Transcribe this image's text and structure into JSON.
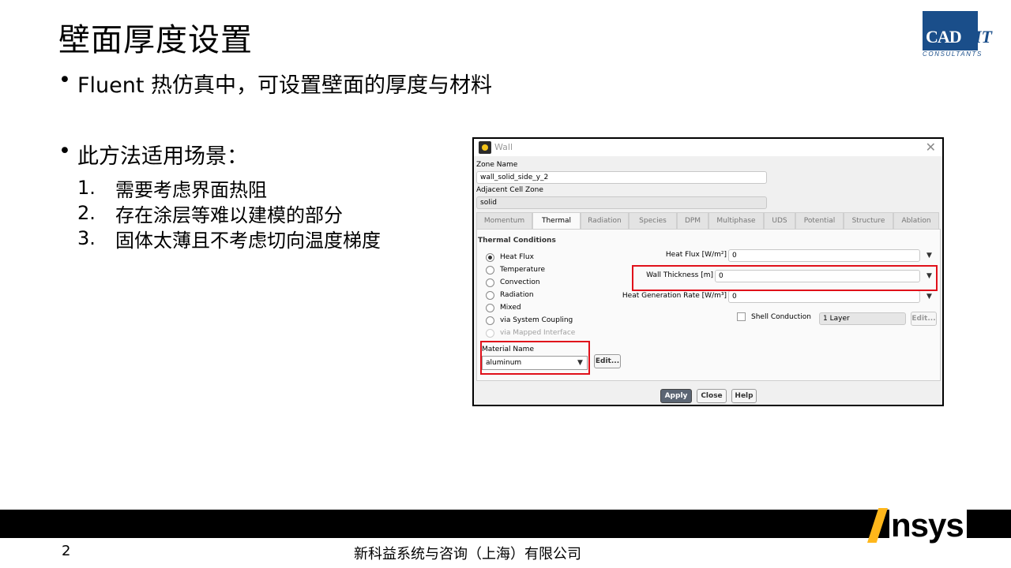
{
  "slide": {
    "title": "壁面厚度设置",
    "bullet1": "Fluent 热仿真中，可设置壁面的厚度与材料",
    "bullet2": "此方法适用场景：",
    "list": [
      {
        "num": "1.",
        "text": "需要考虑界面热阻"
      },
      {
        "num": "2.",
        "text": "存在涂层等难以建模的部分"
      },
      {
        "num": "3.",
        "text": "固体太薄且不考虑切向温度梯度"
      }
    ]
  },
  "logo": {
    "main": "CAD",
    "suffix": "IT",
    "sub": "CONSULTANTS",
    "color": "#1a4e8a"
  },
  "dialog": {
    "title": "Wall",
    "close": "✕",
    "zone_name_label": "Zone Name",
    "zone_name_value": "wall_solid_side_y_2",
    "adjacent_label": "Adjacent Cell Zone",
    "adjacent_value": "solid",
    "tabs": [
      "Momentum",
      "Thermal",
      "Radiation",
      "Species",
      "DPM",
      "Multiphase",
      "UDS",
      "Potential",
      "Structure",
      "Ablation"
    ],
    "active_tab": "Thermal",
    "thermal_conditions_label": "Thermal Conditions",
    "options": [
      {
        "label": "Heat Flux",
        "selected": true,
        "enabled": true
      },
      {
        "label": "Temperature",
        "selected": false,
        "enabled": true
      },
      {
        "label": "Convection",
        "selected": false,
        "enabled": true
      },
      {
        "label": "Radiation",
        "selected": false,
        "enabled": true
      },
      {
        "label": "Mixed",
        "selected": false,
        "enabled": true
      },
      {
        "label": "via System Coupling",
        "selected": false,
        "enabled": true
      },
      {
        "label": "via Mapped Interface",
        "selected": false,
        "enabled": false
      }
    ],
    "heat_flux_label": "Heat Flux [W/m²]",
    "heat_flux_value": "0",
    "wall_thickness_label": "Wall Thickness [m]",
    "wall_thickness_value": "0",
    "heat_gen_label": "Heat Generation Rate [W/m³]",
    "heat_gen_value": "0",
    "shell_conduction_label": "Shell Conduction",
    "layer_value": "1 Layer",
    "edit_label": "Edit...",
    "material_label": "Material Name",
    "material_value": "aluminum",
    "buttons": {
      "apply": "Apply",
      "close": "Close",
      "help": "Help"
    }
  },
  "footer": {
    "brand": "nsys",
    "page": "2",
    "company": "新科益系统与咨询（上海）有限公司"
  },
  "colors": {
    "highlight": "#e0101a",
    "ansys_yellow": "#ffb71b",
    "apply_button": "#5b6573"
  }
}
